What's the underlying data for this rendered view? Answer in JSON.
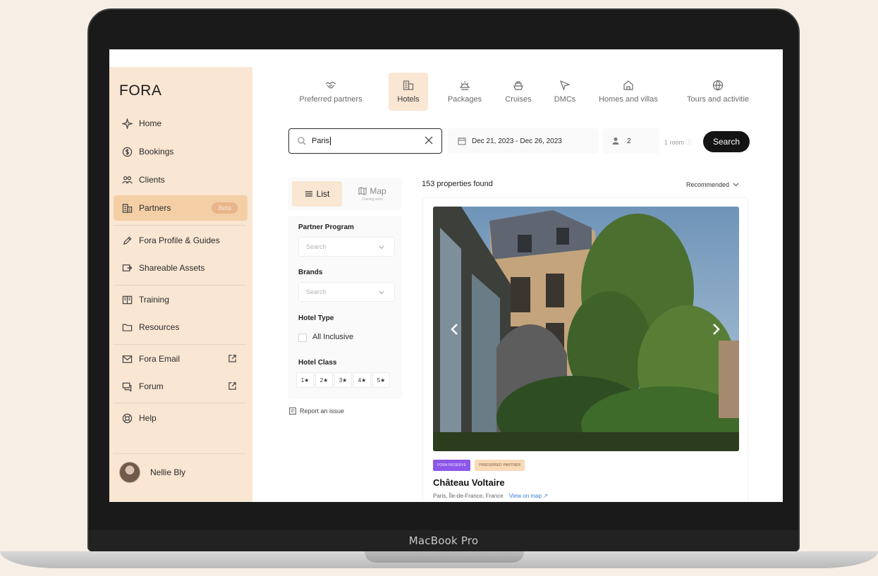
{
  "device": {
    "label": "MacBook Pro"
  },
  "sidebar": {
    "logo": "FORA",
    "items": [
      {
        "label": "Home",
        "icon": "sparkle-icon"
      },
      {
        "label": "Bookings",
        "icon": "dollar-circle-icon"
      },
      {
        "label": "Clients",
        "icon": "people-icon"
      },
      {
        "label": "Partners",
        "icon": "building-icon",
        "badge": "Beta",
        "active": true
      },
      {
        "label": "Fora Profile & Guides",
        "icon": "pen-icon"
      },
      {
        "label": "Shareable Assets",
        "icon": "share-icon"
      },
      {
        "label": "Training",
        "icon": "book-icon"
      },
      {
        "label": "Resources",
        "icon": "folder-icon"
      },
      {
        "label": "Fora Email",
        "icon": "mail-icon",
        "external": true
      },
      {
        "label": "Forum",
        "icon": "chat-icon",
        "external": true
      },
      {
        "label": "Help",
        "icon": "lifebuoy-icon"
      }
    ],
    "user": {
      "name": "Nellie Bly"
    }
  },
  "categories": [
    {
      "label": "Preferred partners",
      "icon": "handshake-icon"
    },
    {
      "label": "Hotels",
      "icon": "hotel-icon",
      "active": true
    },
    {
      "label": "Packages",
      "icon": "sun-icon"
    },
    {
      "label": "Cruises",
      "icon": "ship-icon"
    },
    {
      "label": "DMCs",
      "icon": "navigation-icon"
    },
    {
      "label": "Homes and villas",
      "icon": "house-icon"
    },
    {
      "label": "Tours and activitie",
      "icon": "globe-icon"
    }
  ],
  "search": {
    "destination_value": "Paris",
    "dates": "Dec 21, 2023 - Dec 26, 2023",
    "guests": "2",
    "rooms": "1 room",
    "button_label": "Search"
  },
  "view_toggle": {
    "list_label": "List",
    "map_label": "Map",
    "map_sub": "Coming soon"
  },
  "filters": {
    "partner_program": {
      "label": "Partner Program",
      "placeholder": "Search"
    },
    "brands": {
      "label": "Brands",
      "placeholder": "Search"
    },
    "hotel_type": {
      "label": "Hotel Type",
      "option": "All Inclusive"
    },
    "hotel_class": {
      "label": "Hotel Class",
      "stars": [
        "1★",
        "2★",
        "3★",
        "4★",
        "5★"
      ]
    },
    "report_label": "Report an issue"
  },
  "results": {
    "count_text": "153 properties found",
    "sort_label": "Recommended"
  },
  "card": {
    "badges": {
      "reserve": "FORA RESERVE",
      "partner": "PREFERRED PARTNER"
    },
    "name": "Château Voltaire",
    "location": "Paris, Île-de-France, France",
    "view_map": "View on map"
  }
}
